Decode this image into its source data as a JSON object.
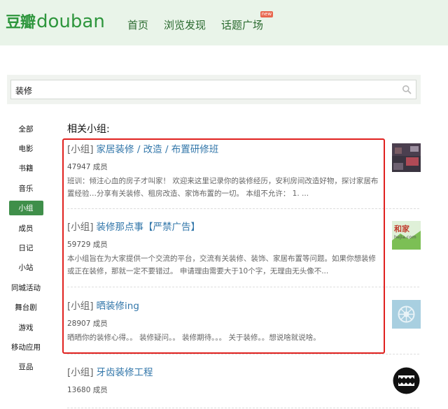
{
  "logo": {
    "cn": "豆瓣",
    "en": "douban"
  },
  "nav": {
    "items": [
      {
        "label": "首页"
      },
      {
        "label": "浏览发现"
      },
      {
        "label": "话题广场",
        "badge": "new"
      }
    ]
  },
  "search": {
    "value": "装修"
  },
  "filters": [
    {
      "label": "全部"
    },
    {
      "label": "电影"
    },
    {
      "label": "书籍"
    },
    {
      "label": "音乐"
    },
    {
      "label": "小组",
      "active": true
    },
    {
      "label": "成员"
    },
    {
      "label": "日记"
    },
    {
      "label": "小站"
    },
    {
      "label": "同城活动"
    },
    {
      "label": "舞台剧"
    },
    {
      "label": "游戏"
    },
    {
      "label": "移动应用"
    },
    {
      "label": "豆品"
    }
  ],
  "results": {
    "heading": "相关小组:",
    "items": [
      {
        "tag": "[小组]",
        "name": "家居装修 / 改造 / 布置研修班",
        "members": "47947 成员",
        "desc": "班训：倾注心血的房子才叫家！ 欢迎来这里记录你的装修经历，安利房间改造好物，探讨家居布置经验…分享有关装修、租房改造、家饰布置的一切。 本组不允许： 1. ...",
        "thumb_icon": "room-photo-icon"
      },
      {
        "tag": "[小组]",
        "name": "装修那点事【严禁广告】",
        "members": "59729 成员",
        "desc": "本小组旨在为大家提供一个交流的平台，交流有关装修、装饰、家居布置等问题。如果你想装修或正在装修，那就一定不要错过。 申请理由需要大于10个字，无理由无头像不...",
        "thumb_icon": "hejia-logo-icon",
        "thumb_text": {
          "top": "和家",
          "bottom": "hejia.com"
        }
      },
      {
        "tag": "[小组]",
        "name": "晒装修ing",
        "members": "28907 成员",
        "desc": "晒晒你的装修心得。。 装修疑问。。 装修期待。。。 关于装修。。想说啥就说啥。",
        "thumb_icon": "flower-emblem-icon"
      },
      {
        "tag": "[小组]",
        "name": "牙齿装修工程",
        "members": "13680 成员",
        "desc": "",
        "thumb_icon": "teeth-badge-icon"
      }
    ]
  },
  "colors": {
    "header_bg": "#e9f4e9",
    "brand_green": "#2e963d",
    "nav_green": "#2a6a2f",
    "active_filter": "#3f8f4a",
    "link_blue": "#3377aa",
    "highlight_red": "#e0211f"
  }
}
